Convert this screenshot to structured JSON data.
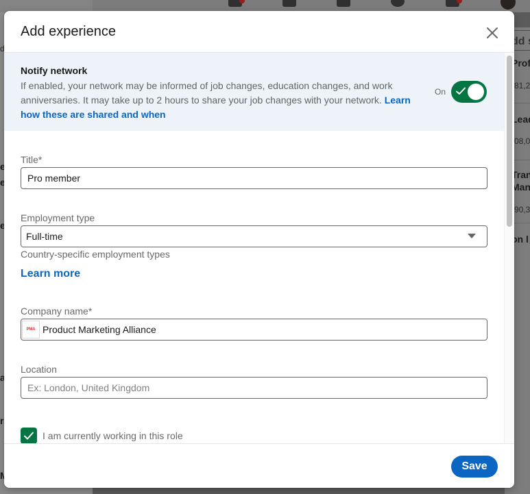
{
  "background": {
    "left_fragments": [
      "d",
      "e",
      "e",
      "e",
      "a",
      "rk",
      "M"
    ],
    "right_fragments": [
      "dd s",
      "Prof",
      "81,2",
      "Lead",
      "08,0",
      "Tran",
      "Mana",
      "90,3",
      "on l"
    ]
  },
  "modal": {
    "title": "Add experience",
    "close_label": "Dismiss"
  },
  "notify": {
    "title": "Notify network",
    "text": "If enabled, your network may be informed of job changes, education changes, and work anniversaries. It may take up to 2 hours to share your job changes with your network. ",
    "link": "Learn how these are shared and when",
    "toggle_label": "On",
    "toggle_on": true
  },
  "form": {
    "title_label": "Title*",
    "title_value": "Pro member",
    "employment_type_label": "Employment type",
    "employment_type_value": "Full-time",
    "employment_helper": "Country-specific employment types",
    "learn_more": "Learn more",
    "company_label": "Company name*",
    "company_value": "Product Marketing Alliance",
    "company_logo_text": "PMA",
    "location_label": "Location",
    "location_placeholder": "Ex: London, United Kingdom",
    "current_role_label": "I am currently working in this role",
    "current_role_checked": true
  },
  "footer": {
    "save_label": "Save"
  },
  "colors": {
    "accent": "#0a66c2",
    "toggle_on": "#057642",
    "notify_bg": "#edf3f8"
  }
}
